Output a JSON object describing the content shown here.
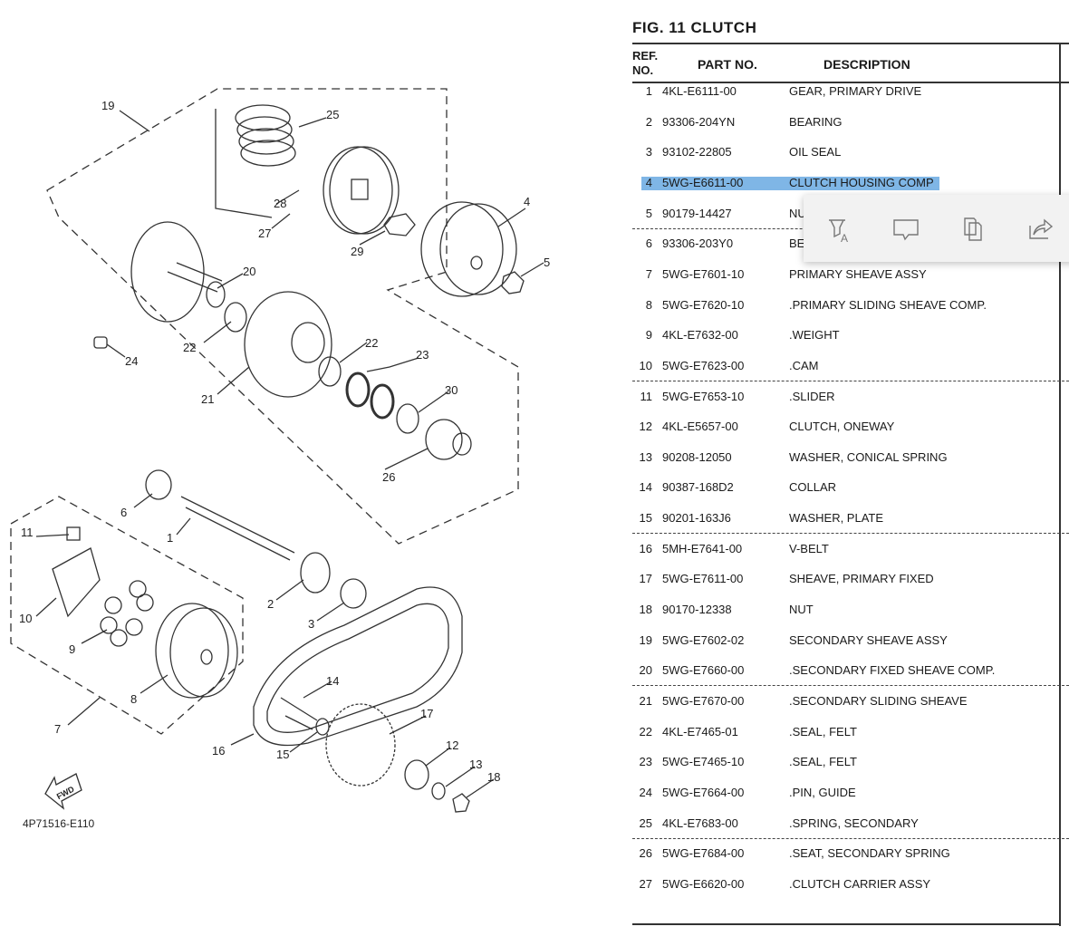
{
  "figure": {
    "title": "FIG.  11   CLUTCH",
    "diagram_code": "4P71516-E110",
    "fwd_label": "FWD",
    "callouts": [
      "19",
      "25",
      "28",
      "27",
      "29",
      "4",
      "5",
      "20",
      "22",
      "24",
      "21",
      "22",
      "23",
      "30",
      "26",
      "6",
      "1",
      "11",
      "10",
      "9",
      "2",
      "3",
      "8",
      "7",
      "14",
      "17",
      "12",
      "13",
      "18",
      "16",
      "15"
    ]
  },
  "table": {
    "headers": {
      "ref_line1": "REF.",
      "ref_line2": "NO.",
      "part_no": "PART NO.",
      "description": "DESCRIPTION"
    },
    "selected_ref": "4",
    "selection_color": "#7fb6e6",
    "rows": [
      {
        "ref": "1",
        "part": "4KL-E6111-00",
        "desc": "GEAR, PRIMARY DRIVE"
      },
      {
        "ref": "2",
        "part": "93306-204YN",
        "desc": "BEARING"
      },
      {
        "ref": "3",
        "part": "93102-22805",
        "desc": "OIL SEAL"
      },
      {
        "ref": "4",
        "part": "5WG-E6611-00",
        "desc": "CLUTCH HOUSING COMP"
      },
      {
        "ref": "5",
        "part": "90179-14427",
        "desc": "NU"
      },
      {
        "ref": "6",
        "part": "93306-203Y0",
        "desc": "BE"
      },
      {
        "ref": "7",
        "part": "5WG-E7601-10",
        "desc": "PRIMARY SHEAVE ASSY"
      },
      {
        "ref": "8",
        "part": "5WG-E7620-10",
        "desc": ".PRIMARY SLIDING SHEAVE COMP."
      },
      {
        "ref": "9",
        "part": "4KL-E7632-00",
        "desc": ".WEIGHT"
      },
      {
        "ref": "10",
        "part": "5WG-E7623-00",
        "desc": ".CAM"
      },
      {
        "ref": "11",
        "part": "5WG-E7653-10",
        "desc": ".SLIDER"
      },
      {
        "ref": "12",
        "part": "4KL-E5657-00",
        "desc": "CLUTCH, ONEWAY"
      },
      {
        "ref": "13",
        "part": "90208-12050",
        "desc": "WASHER, CONICAL SPRING"
      },
      {
        "ref": "14",
        "part": "90387-168D2",
        "desc": "COLLAR"
      },
      {
        "ref": "15",
        "part": "90201-163J6",
        "desc": "WASHER, PLATE"
      },
      {
        "ref": "16",
        "part": "5MH-E7641-00",
        "desc": "V-BELT"
      },
      {
        "ref": "17",
        "part": "5WG-E7611-00",
        "desc": "SHEAVE, PRIMARY FIXED"
      },
      {
        "ref": "18",
        "part": "90170-12338",
        "desc": "NUT"
      },
      {
        "ref": "19",
        "part": "5WG-E7602-02",
        "desc": "SECONDARY SHEAVE ASSY"
      },
      {
        "ref": "20",
        "part": "5WG-E7660-00",
        "desc": ".SECONDARY FIXED SHEAVE COMP."
      },
      {
        "ref": "21",
        "part": "5WG-E7670-00",
        "desc": ".SECONDARY SLIDING SHEAVE"
      },
      {
        "ref": "22",
        "part": "4KL-E7465-01",
        "desc": ".SEAL, FELT"
      },
      {
        "ref": "23",
        "part": "5WG-E7465-10",
        "desc": ".SEAL, FELT"
      },
      {
        "ref": "24",
        "part": "5WG-E7664-00",
        "desc": ".PIN, GUIDE"
      },
      {
        "ref": "25",
        "part": "4KL-E7683-00",
        "desc": ".SPRING, SECONDARY"
      },
      {
        "ref": "26",
        "part": "5WG-E7684-00",
        "desc": ".SEAT, SECONDARY SPRING"
      },
      {
        "ref": "27",
        "part": "5WG-E6620-00",
        "desc": ".CLUTCH CARRIER ASSY"
      }
    ]
  },
  "popup_toolbar": {
    "buttons": [
      {
        "icon": "highlight-text-icon"
      },
      {
        "icon": "comment-icon"
      },
      {
        "icon": "copy-icon"
      },
      {
        "icon": "share-icon"
      }
    ]
  }
}
